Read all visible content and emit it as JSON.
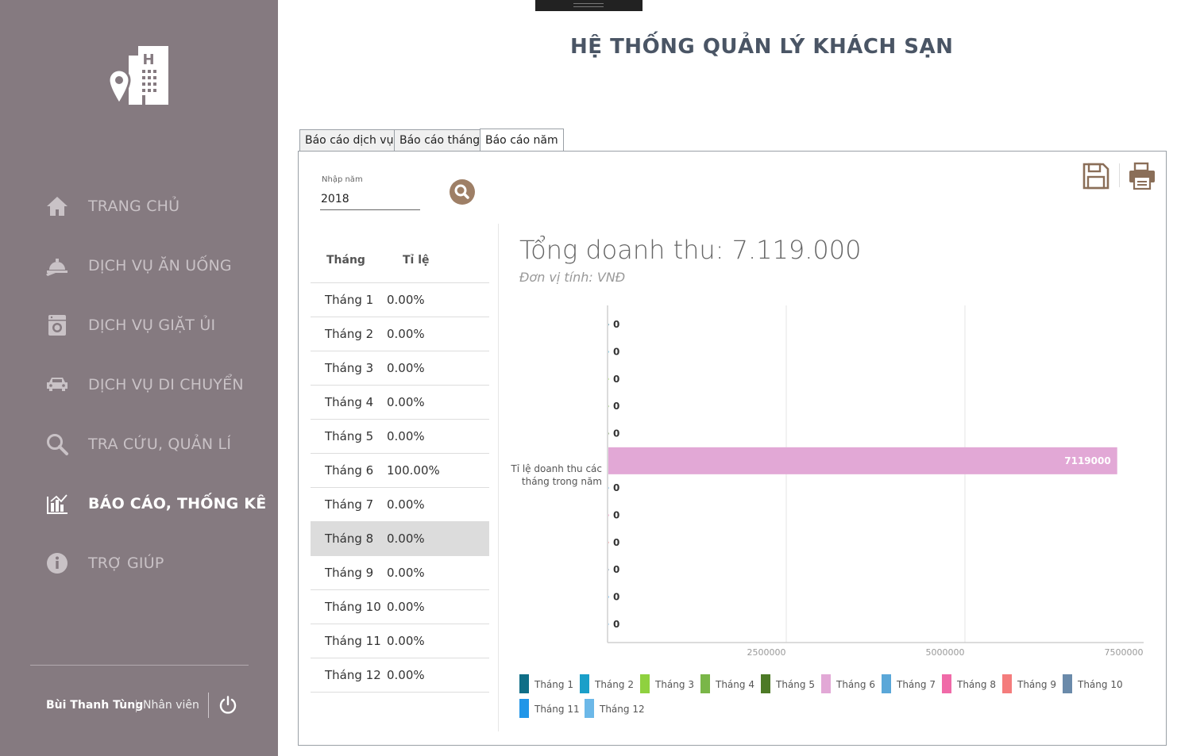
{
  "app": {
    "title": "HỆ THỐNG QUẢN LÝ KHÁCH SẠN"
  },
  "sidebar": {
    "logo_icon": "hotel-location-icon",
    "items": [
      {
        "label": "TRANG CHỦ",
        "icon": "home-icon"
      },
      {
        "label": "DỊCH VỤ ĂN UỐNG",
        "icon": "room-service-icon"
      },
      {
        "label": "DỊCH VỤ GIẶT ỦI",
        "icon": "washing-machine-icon"
      },
      {
        "label": "DỊCH VỤ DI CHUYỂN",
        "icon": "car-icon"
      },
      {
        "label": "TRA CỨU, QUẢN LÍ",
        "icon": "search-icon"
      },
      {
        "label": "BÁO CÁO, THỐNG KÊ",
        "icon": "report-chart-icon",
        "active": true
      },
      {
        "label": "TRỢ GIÚP",
        "icon": "info-icon"
      }
    ],
    "user": {
      "name": "Bùi Thanh Tùng",
      "role": "Nhân viên"
    },
    "background": "#857a80"
  },
  "tabs": [
    {
      "label": "Báo cáo dịch vụ"
    },
    {
      "label": "Báo cáo tháng"
    },
    {
      "label": "Báo cáo năm",
      "active": true
    }
  ],
  "filter": {
    "year_label": "Nhập năm",
    "year_value": "2018",
    "search_icon": "search-icon",
    "accent": "#9e7f66"
  },
  "toolbar": {
    "save_icon": "save-icon",
    "print_icon": "printer-icon"
  },
  "table": {
    "headers": [
      "Tháng",
      "Tỉ lệ"
    ],
    "rows": [
      {
        "month": "Tháng 1",
        "ratio": "0.00%"
      },
      {
        "month": "Tháng 2",
        "ratio": "0.00%"
      },
      {
        "month": "Tháng 3",
        "ratio": "0.00%"
      },
      {
        "month": "Tháng 4",
        "ratio": "0.00%"
      },
      {
        "month": "Tháng 5",
        "ratio": "0.00%"
      },
      {
        "month": "Tháng 6",
        "ratio": "100.00%"
      },
      {
        "month": "Tháng 7",
        "ratio": "0.00%"
      },
      {
        "month": "Tháng 8",
        "ratio": "0.00%",
        "selected": true
      },
      {
        "month": "Tháng 9",
        "ratio": "0.00%"
      },
      {
        "month": "Tháng 10",
        "ratio": "0.00%"
      },
      {
        "month": "Tháng 11",
        "ratio": "0.00%"
      },
      {
        "month": "Tháng 12",
        "ratio": "0.00%"
      }
    ]
  },
  "report": {
    "total_label": "Tổng doanh thu: 7.119.000",
    "unit_label": "Đơn vị tính: VNĐ"
  },
  "chart_data": {
    "type": "bar",
    "orientation": "horizontal",
    "category_label": "Tỉ lệ doanh thu các tháng trong năm",
    "xlim": [
      0,
      7500000
    ],
    "xticks": [
      2500000,
      5000000,
      7500000
    ],
    "grid": true,
    "legend_position": "bottom",
    "series": [
      {
        "name": "Tháng 1",
        "value": 0,
        "color": "#0f6e87"
      },
      {
        "name": "Tháng 2",
        "value": 0,
        "color": "#1a9fc9"
      },
      {
        "name": "Tháng 3",
        "value": 0,
        "color": "#8fd13f"
      },
      {
        "name": "Tháng 4",
        "value": 0,
        "color": "#7ab648"
      },
      {
        "name": "Tháng 5",
        "value": 0,
        "color": "#4d7a26"
      },
      {
        "name": "Tháng 6",
        "value": 7119000,
        "color": "#e2a8d6"
      },
      {
        "name": "Tháng 7",
        "value": 0,
        "color": "#5aa7d8"
      },
      {
        "name": "Tháng 8",
        "value": 0,
        "color": "#f06aa8"
      },
      {
        "name": "Tháng 9",
        "value": 0,
        "color": "#f47c7c"
      },
      {
        "name": "Tháng 10",
        "value": 0,
        "color": "#6a8aaa"
      },
      {
        "name": "Tháng 11",
        "value": 0,
        "color": "#2196e8"
      },
      {
        "name": "Tháng 12",
        "value": 0,
        "color": "#6cb8e8"
      }
    ]
  }
}
